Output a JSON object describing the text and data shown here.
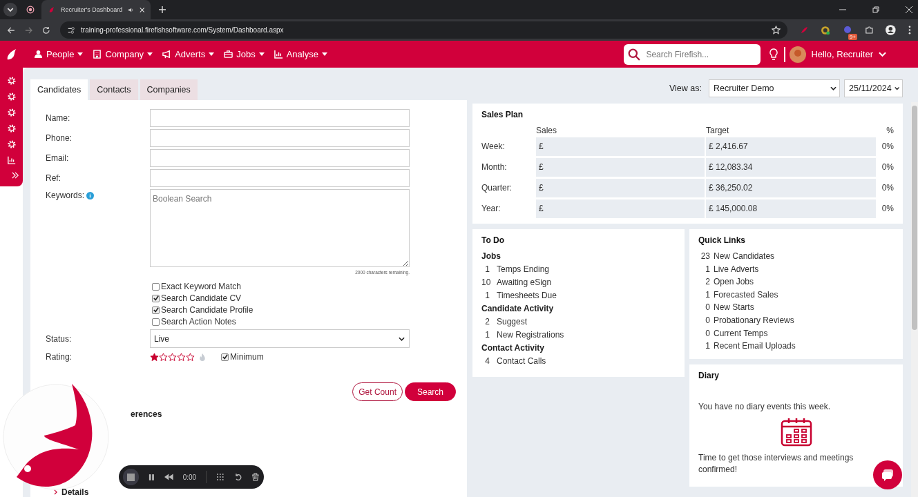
{
  "browser": {
    "tab_title": "Recruiter's Dashboard",
    "url": "training-professional.firefishsoftware.com/System/Dashboard.aspx",
    "extension_badge": "9+"
  },
  "nav": {
    "items": [
      {
        "label": "People",
        "kind": "person"
      },
      {
        "label": "Company",
        "kind": "building"
      },
      {
        "label": "Adverts",
        "kind": "megaphone"
      },
      {
        "label": "Jobs",
        "kind": "briefcase"
      },
      {
        "label": "Analyse",
        "kind": "chart"
      }
    ],
    "search_placeholder": "Search Firefish...",
    "user": "Hello, Recruiter"
  },
  "sidebar": {
    "items": [
      {
        "kind": "gear"
      },
      {
        "kind": "gear"
      },
      {
        "kind": "gear"
      },
      {
        "kind": "gear"
      },
      {
        "kind": "gear"
      },
      {
        "kind": "chart"
      },
      {
        "kind": "expand"
      }
    ]
  },
  "search_tabs": [
    {
      "label": "Candidates",
      "selected": true
    },
    {
      "label": "Contacts",
      "selected": false
    },
    {
      "label": "Companies",
      "selected": false
    }
  ],
  "view_as": {
    "label": "View as:",
    "user": "Recruiter Demo",
    "date": "25/11/2024"
  },
  "form": {
    "fields": [
      {
        "label": "Name:"
      },
      {
        "label": "Phone:"
      },
      {
        "label": "Email:"
      },
      {
        "label": "Ref:"
      }
    ],
    "keywords": {
      "label": "Keywords:",
      "placeholder": "Boolean Search",
      "remaining": "2000 characters remaining."
    },
    "options": [
      {
        "label": "Exact Keyword Match",
        "checked": false
      },
      {
        "label": "Search Candidate CV",
        "checked": true
      },
      {
        "label": "Search Candidate Profile",
        "checked": true
      },
      {
        "label": "Search Action Notes",
        "checked": false
      }
    ],
    "status": {
      "label": "Status:",
      "value": "Live"
    },
    "rating": {
      "label": "Rating:",
      "stars": 1,
      "minimum": {
        "label": "Minimum",
        "checked": true
      }
    },
    "buttons": {
      "get_count": "Get Count",
      "search": "Search"
    },
    "sections": [
      {
        "label": "erences"
      },
      {
        "label": "Details"
      }
    ]
  },
  "sales_plan": {
    "title": "Sales Plan",
    "columns": [
      "Sales",
      "Target",
      "%"
    ],
    "rows": [
      {
        "label": "Week:",
        "sales": "£",
        "target": "£ 2,416.67",
        "percent": "0%"
      },
      {
        "label": "Month:",
        "sales": "£",
        "target": "£ 12,083.34",
        "percent": "0%"
      },
      {
        "label": "Quarter:",
        "sales": "£",
        "target": "£ 36,250.02",
        "percent": "0%"
      },
      {
        "label": "Year:",
        "sales": "£",
        "target": "£ 145,000.08",
        "percent": "0%"
      }
    ]
  },
  "todo": {
    "title": "To Do",
    "groups": [
      {
        "title": "Jobs",
        "items": [
          {
            "count": "1",
            "label": "Temps Ending"
          },
          {
            "count": "10",
            "label": "Awaiting eSign"
          },
          {
            "count": "1",
            "label": "Timesheets Due"
          }
        ]
      },
      {
        "title": "Candidate Activity",
        "items": [
          {
            "count": "2",
            "label": "Suggest"
          },
          {
            "count": "1",
            "label": "New Registrations"
          }
        ]
      },
      {
        "title": "Contact Activity",
        "items": [
          {
            "count": "4",
            "label": "Contact Calls"
          }
        ]
      }
    ]
  },
  "quick_links": {
    "title": "Quick Links",
    "items": [
      {
        "count": "23",
        "label": "New Candidates"
      },
      {
        "count": "1",
        "label": "Live Adverts"
      },
      {
        "count": "2",
        "label": "Open Jobs"
      },
      {
        "count": "1",
        "label": "Forecasted Sales"
      },
      {
        "count": "0",
        "label": "New Starts"
      },
      {
        "count": "0",
        "label": "Probationary Reviews"
      },
      {
        "count": "0",
        "label": "Current Temps"
      },
      {
        "count": "1",
        "label": "Recent Email Uploads"
      }
    ]
  },
  "diary": {
    "title": "Diary",
    "message": "You have no diary events this week.",
    "note": "Time to get those interviews and meetings confirmed!"
  },
  "recorder": {
    "time": "0:00"
  }
}
